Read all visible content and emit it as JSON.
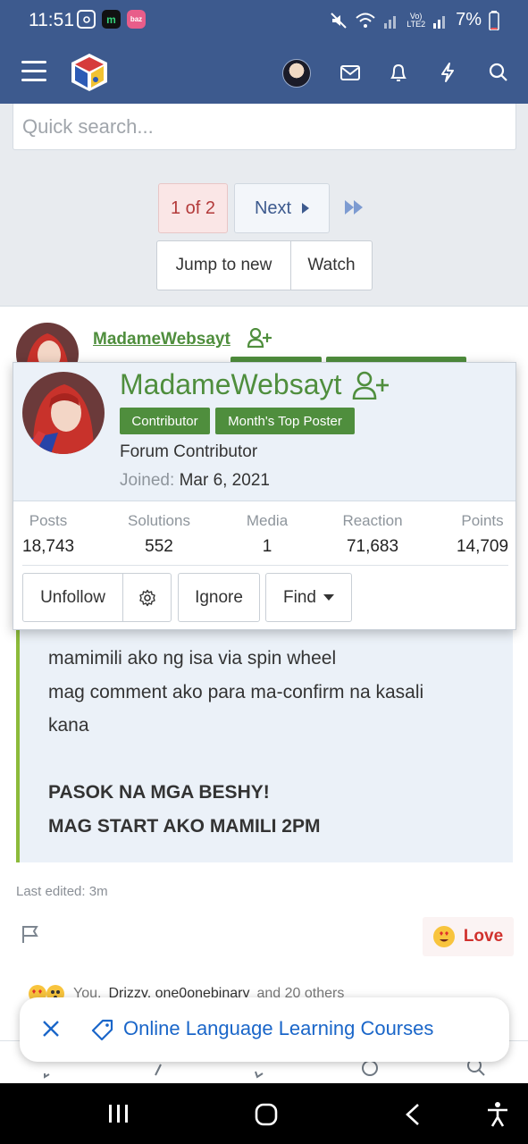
{
  "status_bar": {
    "time": "11:51",
    "battery": "7%",
    "network_top": "Vo)",
    "network_bottom": "LTE2",
    "app_icons": [
      "instagram-icon",
      "m-app-icon",
      "bazaar-icon"
    ],
    "bazaar_label": "baz"
  },
  "header": {
    "icons": [
      "menu-icon",
      "logo",
      "avatar",
      "mail-icon",
      "bell-icon",
      "bolt-icon",
      "search-icon"
    ]
  },
  "search": {
    "placeholder": "Quick search..."
  },
  "pagination": {
    "current": "1 of 2",
    "next": "Next"
  },
  "thread_actions": {
    "jump": "Jump to new",
    "watch": "Watch"
  },
  "post": {
    "username": "MadameWebsayt",
    "quote_lines": [
      "mamimili ako ng isa via spin wheel",
      "mag comment ako para ma-confirm na kasali",
      "kana",
      "PASOK NA MGA BESHY!",
      "MAG START AKO MAMILI 2PM"
    ],
    "last_edited": "Last edited: 3m",
    "reaction_label": "Love",
    "reactions_you": "You,",
    "reactions_names": "Drizzy, one0onebinary",
    "reactions_others": "and 20 others"
  },
  "member_card": {
    "name": "MadameWebsayt",
    "badges": [
      "Contributor",
      "Month's Top Poster"
    ],
    "title": "Forum Contributor",
    "joined_label": "Joined:",
    "joined_value": "Mar 6, 2021",
    "stats": [
      {
        "label": "Posts",
        "value": "18,743"
      },
      {
        "label": "Solutions",
        "value": "552"
      },
      {
        "label": "Media",
        "value": "1"
      },
      {
        "label": "Reaction",
        "value": "71,683"
      },
      {
        "label": "Points",
        "value": "14,709"
      }
    ],
    "buttons": {
      "unfollow": "Unfollow",
      "ignore": "Ignore",
      "find": "Find"
    }
  },
  "toast": {
    "label": "Online Language Learning Courses"
  },
  "colors": {
    "header": "#3d5a8e",
    "username_green": "#4f8e3d",
    "quote_bar": "#8cba3a",
    "love_red": "#d0312d",
    "link_blue": "#1a66c9"
  }
}
